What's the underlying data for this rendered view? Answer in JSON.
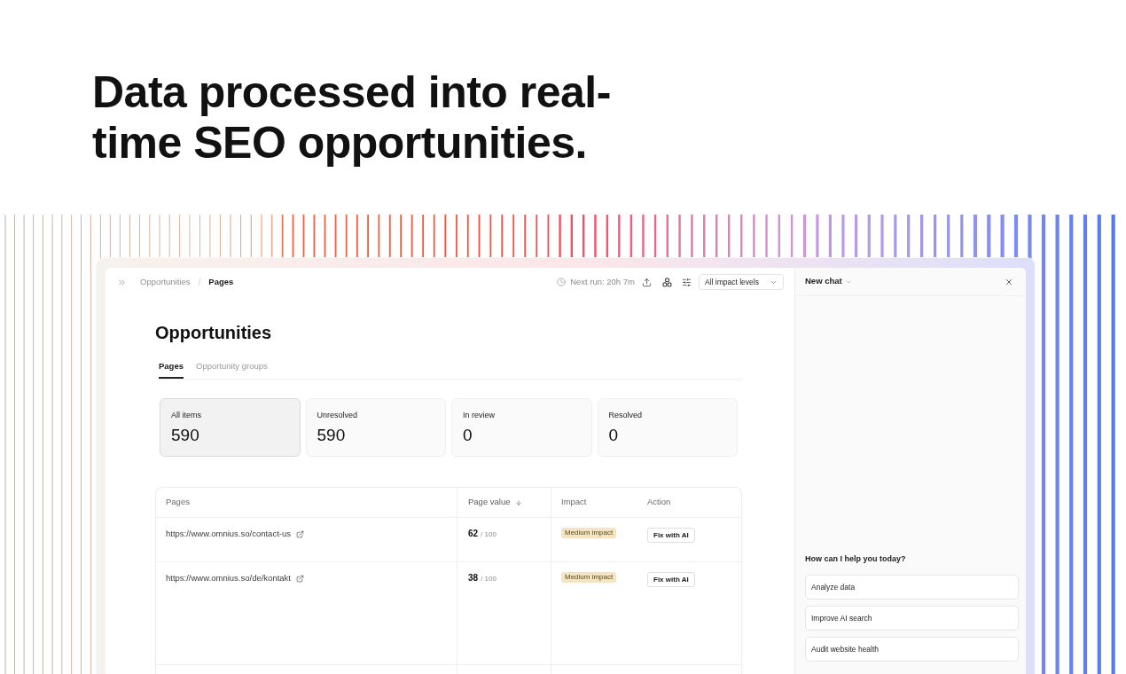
{
  "headline": "Data processed into real-time SEO opportunities.",
  "topbar": {
    "breadcrumb": [
      {
        "label": "Opportunities",
        "current": false
      },
      {
        "label": "Pages",
        "current": true
      }
    ],
    "separator": "/",
    "next_run": "Next run: 20h 7m",
    "impact_filter": "All impact levels"
  },
  "page": {
    "title": "Opportunities",
    "tabs": [
      {
        "label": "Pages",
        "selected": true
      },
      {
        "label": "Opportunity groups",
        "selected": false
      }
    ],
    "stats": [
      {
        "label": "All items",
        "value": "590",
        "selected": true
      },
      {
        "label": "Unresolved",
        "value": "590",
        "selected": false
      },
      {
        "label": "In review",
        "value": "0",
        "selected": false
      },
      {
        "label": "Resolved",
        "value": "0",
        "selected": false
      }
    ]
  },
  "table": {
    "columns": [
      {
        "label": "Pages",
        "sorted_descending": false
      },
      {
        "label": "Page value",
        "sorted_descending": true
      },
      {
        "label": "Impact",
        "sorted_descending": false
      },
      {
        "label": "Action",
        "sorted_descending": false
      }
    ],
    "rows": [
      {
        "url": "https://www.omnius.so/contact-us",
        "score": "62",
        "score_max": "/ 100",
        "impact": "Medium impact",
        "action": "Fix with AI"
      },
      {
        "url": "https://www.omnius.so/de/kontakt",
        "score": "38",
        "score_max": "/ 100",
        "impact": "Medium impact",
        "action": "Fix with AI"
      }
    ]
  },
  "chat": {
    "title": "New chat",
    "prompt": "How can I help you today?",
    "suggestions": [
      {
        "label": "Analyze data"
      },
      {
        "label": "Improve AI search"
      },
      {
        "label": "Audit website health"
      }
    ]
  }
}
